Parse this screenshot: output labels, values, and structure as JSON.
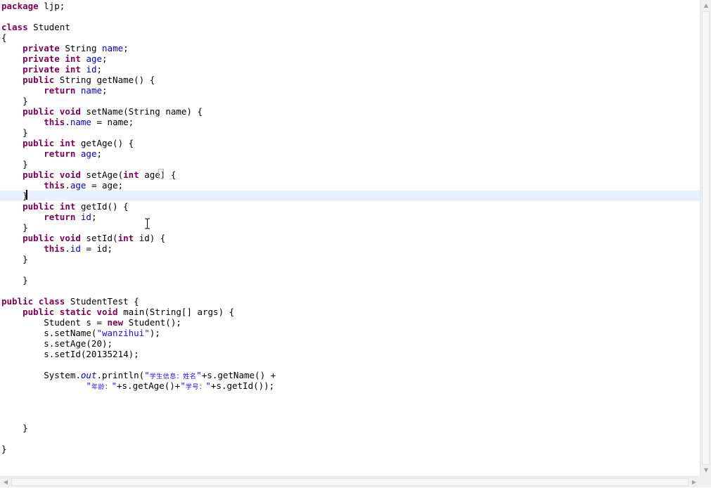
{
  "editor": {
    "lines": [
      {
        "parts": [
          {
            "t": "package",
            "c": "kw"
          },
          {
            "t": " ljp;"
          }
        ]
      },
      {
        "parts": []
      },
      {
        "parts": [
          {
            "t": "class",
            "c": "kw"
          },
          {
            "t": " Student"
          }
        ]
      },
      {
        "parts": [
          {
            "t": "{"
          }
        ]
      },
      {
        "parts": [
          {
            "t": "    "
          },
          {
            "t": "private",
            "c": "kw"
          },
          {
            "t": " String "
          },
          {
            "t": "name",
            "c": "fld"
          },
          {
            "t": ";"
          }
        ]
      },
      {
        "parts": [
          {
            "t": "    "
          },
          {
            "t": "private",
            "c": "kw"
          },
          {
            "t": " "
          },
          {
            "t": "int",
            "c": "kw"
          },
          {
            "t": " "
          },
          {
            "t": "age",
            "c": "fld"
          },
          {
            "t": ";"
          }
        ]
      },
      {
        "parts": [
          {
            "t": "    "
          },
          {
            "t": "private",
            "c": "kw"
          },
          {
            "t": " "
          },
          {
            "t": "int",
            "c": "kw"
          },
          {
            "t": " "
          },
          {
            "t": "id",
            "c": "fld"
          },
          {
            "t": ";"
          }
        ]
      },
      {
        "parts": [
          {
            "t": "    "
          },
          {
            "t": "public",
            "c": "kw"
          },
          {
            "t": " String getName() {"
          }
        ]
      },
      {
        "parts": [
          {
            "t": "        "
          },
          {
            "t": "return",
            "c": "kw"
          },
          {
            "t": " "
          },
          {
            "t": "name",
            "c": "fld"
          },
          {
            "t": ";"
          }
        ]
      },
      {
        "parts": [
          {
            "t": "    }"
          }
        ]
      },
      {
        "parts": [
          {
            "t": "    "
          },
          {
            "t": "public",
            "c": "kw"
          },
          {
            "t": " "
          },
          {
            "t": "void",
            "c": "kw"
          },
          {
            "t": " setName(String name) {"
          }
        ]
      },
      {
        "parts": [
          {
            "t": "        "
          },
          {
            "t": "this",
            "c": "kw"
          },
          {
            "t": "."
          },
          {
            "t": "name",
            "c": "fld"
          },
          {
            "t": " = name;"
          }
        ]
      },
      {
        "parts": [
          {
            "t": "    }"
          }
        ]
      },
      {
        "parts": [
          {
            "t": "    "
          },
          {
            "t": "public",
            "c": "kw"
          },
          {
            "t": " "
          },
          {
            "t": "int",
            "c": "kw"
          },
          {
            "t": " getAge() {"
          }
        ]
      },
      {
        "parts": [
          {
            "t": "        "
          },
          {
            "t": "return",
            "c": "kw"
          },
          {
            "t": " "
          },
          {
            "t": "age",
            "c": "fld"
          },
          {
            "t": ";"
          }
        ]
      },
      {
        "parts": [
          {
            "t": "    }"
          }
        ]
      },
      {
        "parts": [
          {
            "t": "    "
          },
          {
            "t": "public",
            "c": "kw"
          },
          {
            "t": " "
          },
          {
            "t": "void",
            "c": "kw"
          },
          {
            "t": " setAge("
          },
          {
            "t": "int",
            "c": "kw"
          },
          {
            "t": " age) {"
          }
        ]
      },
      {
        "parts": [
          {
            "t": "        "
          },
          {
            "t": "this",
            "c": "kw"
          },
          {
            "t": "."
          },
          {
            "t": "age",
            "c": "fld"
          },
          {
            "t": " = age;"
          }
        ]
      },
      {
        "parts": [
          {
            "t": "    }"
          }
        ],
        "current": true
      },
      {
        "parts": [
          {
            "t": "    "
          },
          {
            "t": "public",
            "c": "kw"
          },
          {
            "t": " "
          },
          {
            "t": "int",
            "c": "kw"
          },
          {
            "t": " getId() {"
          }
        ]
      },
      {
        "parts": [
          {
            "t": "        "
          },
          {
            "t": "return",
            "c": "kw"
          },
          {
            "t": " "
          },
          {
            "t": "id",
            "c": "fld"
          },
          {
            "t": ";"
          }
        ]
      },
      {
        "parts": [
          {
            "t": "    }"
          }
        ]
      },
      {
        "parts": [
          {
            "t": "    "
          },
          {
            "t": "public",
            "c": "kw"
          },
          {
            "t": " "
          },
          {
            "t": "void",
            "c": "kw"
          },
          {
            "t": " setId("
          },
          {
            "t": "int",
            "c": "kw"
          },
          {
            "t": " id) {"
          }
        ]
      },
      {
        "parts": [
          {
            "t": "        "
          },
          {
            "t": "this",
            "c": "kw"
          },
          {
            "t": "."
          },
          {
            "t": "id",
            "c": "fld"
          },
          {
            "t": " = id;"
          }
        ]
      },
      {
        "parts": [
          {
            "t": "    }"
          }
        ]
      },
      {
        "parts": []
      },
      {
        "parts": [
          {
            "t": "    }"
          }
        ]
      },
      {
        "parts": []
      },
      {
        "parts": [
          {
            "t": "public",
            "c": "kw"
          },
          {
            "t": " "
          },
          {
            "t": "class",
            "c": "kw"
          },
          {
            "t": " StudentTest {"
          }
        ]
      },
      {
        "parts": [
          {
            "t": "    "
          },
          {
            "t": "public",
            "c": "kw"
          },
          {
            "t": " "
          },
          {
            "t": "static",
            "c": "kw"
          },
          {
            "t": " "
          },
          {
            "t": "void",
            "c": "kw"
          },
          {
            "t": " main(String[] args) {"
          }
        ]
      },
      {
        "parts": [
          {
            "t": "        Student s = "
          },
          {
            "t": "new",
            "c": "kw"
          },
          {
            "t": " Student();"
          }
        ]
      },
      {
        "parts": [
          {
            "t": "        s.setName("
          },
          {
            "t": "\"wanzihui\"",
            "c": "str"
          },
          {
            "t": ");"
          }
        ]
      },
      {
        "parts": [
          {
            "t": "        s.setAge(20);"
          }
        ]
      },
      {
        "parts": [
          {
            "t": "        s.setId(20135214);"
          }
        ]
      },
      {
        "parts": []
      },
      {
        "parts": [
          {
            "t": "        System."
          },
          {
            "t": "out",
            "c": "sfld"
          },
          {
            "t": ".println("
          },
          {
            "t": "\"",
            "c": "str"
          },
          {
            "t": "学生信息：姓名",
            "c": "garb"
          },
          {
            "t": "\"",
            "c": "str"
          },
          {
            "t": "+s.getName() +"
          }
        ]
      },
      {
        "parts": [
          {
            "t": "                "
          },
          {
            "t": "\"",
            "c": "str"
          },
          {
            "t": "年龄：",
            "c": "garb"
          },
          {
            "t": "\"",
            "c": "str"
          },
          {
            "t": "+s.getAge()+"
          },
          {
            "t": "\"",
            "c": "str"
          },
          {
            "t": "学号：",
            "c": "garb"
          },
          {
            "t": "\"",
            "c": "str"
          },
          {
            "t": "+s.getId());"
          }
        ]
      },
      {
        "parts": []
      },
      {
        "parts": []
      },
      {
        "parts": []
      },
      {
        "parts": [
          {
            "t": "    }"
          }
        ]
      },
      {
        "parts": []
      },
      {
        "parts": [
          {
            "t": "}"
          }
        ]
      }
    ]
  },
  "colors": {
    "keyword": "#7f0055",
    "field": "#0000c0",
    "string": "#2a00ff",
    "current_line": "#e8f2fe"
  },
  "icons": [
    "text-cursor-icon",
    "scroll-up-arrow-icon",
    "scroll-down-arrow-icon",
    "scroll-left-arrow-icon",
    "scroll-right-arrow-icon"
  ]
}
